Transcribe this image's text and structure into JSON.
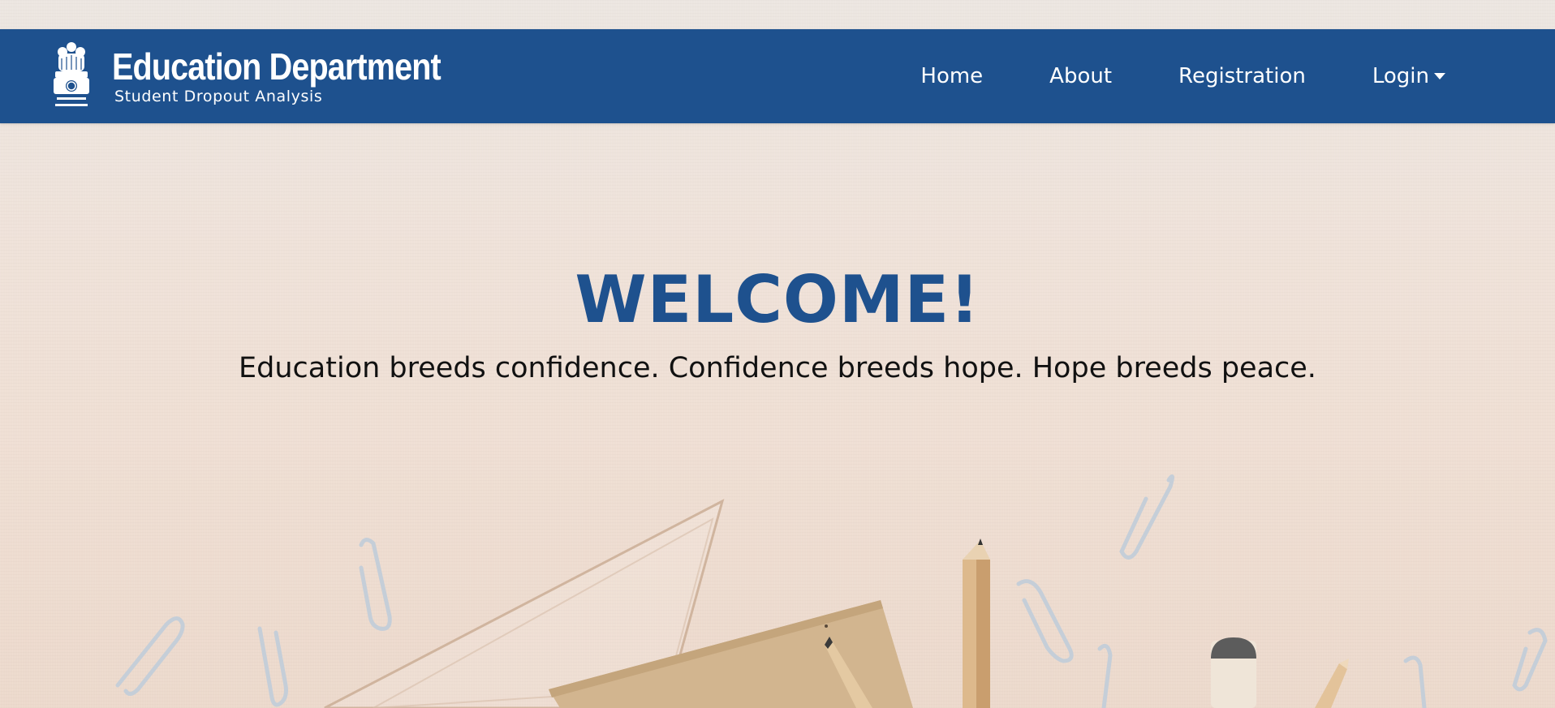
{
  "header": {
    "brand_title": "Education Department",
    "brand_subtitle": "Student Dropout Analysis",
    "emblem_icon": "national-emblem-icon"
  },
  "nav": {
    "items": [
      {
        "label": "Home"
      },
      {
        "label": "About"
      },
      {
        "label": "Registration"
      },
      {
        "label": "Login"
      }
    ],
    "login_icon": "caret-down-icon"
  },
  "hero": {
    "title": "WELCOME!",
    "quote": "Education breeds confidence. Confidence breeds hope. Hope breeds peace."
  },
  "colors": {
    "navbar": "#1e518e",
    "title": "#1e518e",
    "text": "#111111"
  }
}
